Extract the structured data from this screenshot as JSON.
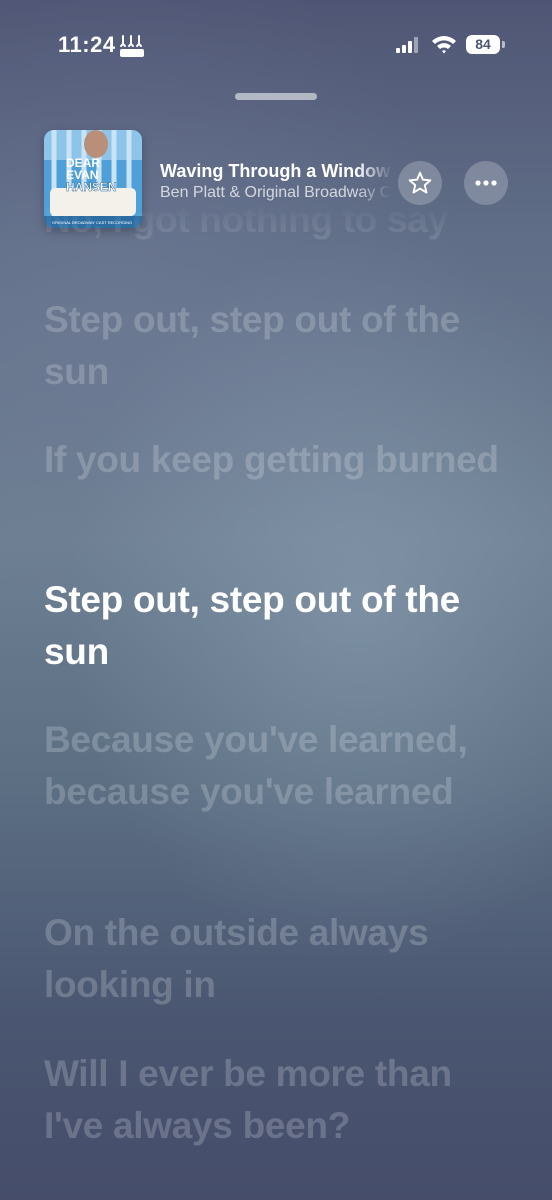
{
  "status_bar": {
    "time": "11:24",
    "battery": "84"
  },
  "now_playing": {
    "title": "Waving Through a Window",
    "artist": "Ben Platt & Original Broadway Cast of Dear Evan Hansen",
    "album_art": {
      "line1": "DEAR",
      "line2": "EVAN",
      "line3": "HANSEN",
      "caption": "ORIGINAL BROADWAY CAST RECORDING"
    }
  },
  "lyrics": [
    {
      "text": "No, I got nothing to say",
      "active": false
    },
    {
      "text": "Step out, step out of the sun",
      "active": false
    },
    {
      "text": "If you keep getting burned",
      "active": false
    },
    {
      "text": "Step out, step out of the sun",
      "active": true
    },
    {
      "text": "Because you've learned, because you've learned",
      "active": false
    },
    {
      "text": "On the outside always looking in",
      "active": false
    },
    {
      "text": "Will I ever be more than I've always been?",
      "active": false
    }
  ],
  "colors": {
    "active_lyric": "#ffffff",
    "inactive_lyric": "rgba(255,255,255,0.2)"
  }
}
